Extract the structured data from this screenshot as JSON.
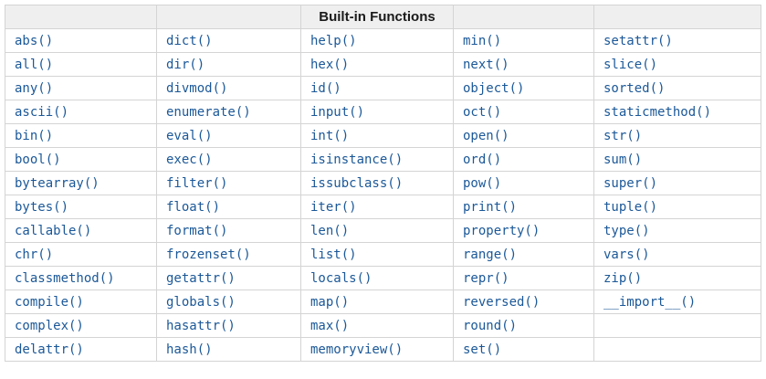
{
  "colors": {
    "link": "#1b5898",
    "header_bg": "#efefef",
    "border": "#d4d4d4",
    "header_text": "#1a1a1a"
  },
  "table": {
    "title": "Built-in Functions",
    "header_cells": [
      "",
      "",
      "Built-in Functions",
      "",
      ""
    ],
    "rows": [
      [
        "abs()",
        "dict()",
        "help()",
        "min()",
        "setattr()"
      ],
      [
        "all()",
        "dir()",
        "hex()",
        "next()",
        "slice()"
      ],
      [
        "any()",
        "divmod()",
        "id()",
        "object()",
        "sorted()"
      ],
      [
        "ascii()",
        "enumerate()",
        "input()",
        "oct()",
        "staticmethod()"
      ],
      [
        "bin()",
        "eval()",
        "int()",
        "open()",
        "str()"
      ],
      [
        "bool()",
        "exec()",
        "isinstance()",
        "ord()",
        "sum()"
      ],
      [
        "bytearray()",
        "filter()",
        "issubclass()",
        "pow()",
        "super()"
      ],
      [
        "bytes()",
        "float()",
        "iter()",
        "print()",
        "tuple()"
      ],
      [
        "callable()",
        "format()",
        "len()",
        "property()",
        "type()"
      ],
      [
        "chr()",
        "frozenset()",
        "list()",
        "range()",
        "vars()"
      ],
      [
        "classmethod()",
        "getattr()",
        "locals()",
        "repr()",
        "zip()"
      ],
      [
        "compile()",
        "globals()",
        "map()",
        "reversed()",
        "__import__()"
      ],
      [
        "complex()",
        "hasattr()",
        "max()",
        "round()",
        ""
      ],
      [
        "delattr()",
        "hash()",
        "memoryview()",
        "set()",
        ""
      ]
    ]
  }
}
